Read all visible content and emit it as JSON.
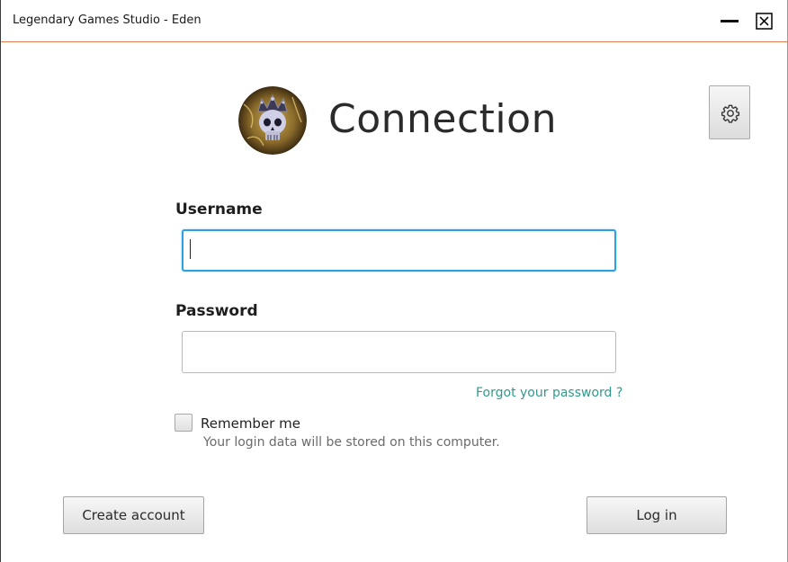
{
  "window": {
    "title": "Legendary Games Studio - Eden",
    "accent_color": "#e08050"
  },
  "header": {
    "heading": "Connection",
    "logo_icon": "crowned-skull-icon",
    "settings_icon": "gear-icon"
  },
  "form": {
    "username_label": "Username",
    "username_value": "",
    "password_label": "Password",
    "password_value": "",
    "forgot_password": "Forgot your password ?",
    "remember_label": "Remember me",
    "remember_checked": false,
    "remember_hint": "Your login data will be stored on this computer."
  },
  "actions": {
    "create_account": "Create account",
    "login": "Log in"
  },
  "colors": {
    "focus_border": "#2e9fdf",
    "link": "#2f9a8c"
  }
}
